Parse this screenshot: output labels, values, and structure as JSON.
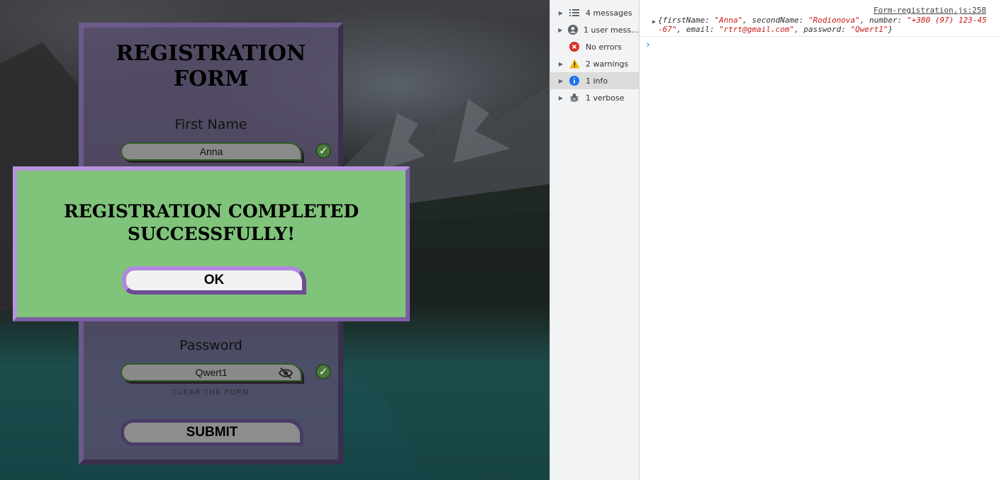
{
  "form": {
    "title": "REGISTRATION FORM",
    "first_name_label": "First Name",
    "first_name_value": "Anna",
    "password_label": "Password",
    "password_value": "Qwert1",
    "clear_label": "CLEAR THE FORM",
    "submit_label": "SUBMIT",
    "check_glyph": "✓"
  },
  "modal": {
    "message": "REGISTRATION COMPLETED SUCCESSFULLY!",
    "ok_label": "OK"
  },
  "devtools": {
    "sidebar": [
      {
        "label": "4 messages",
        "icon": "list-icon",
        "expandable": true
      },
      {
        "label": "1 user mess…",
        "icon": "user-icon",
        "expandable": true
      },
      {
        "label": "No errors",
        "icon": "error-icon",
        "expandable": false
      },
      {
        "label": "2 warnings",
        "icon": "warning-icon",
        "expandable": true
      },
      {
        "label": "1 info",
        "icon": "info-icon",
        "expandable": true,
        "selected": true
      },
      {
        "label": "1 verbose",
        "icon": "bug-icon",
        "expandable": true
      }
    ],
    "source_link": "Form-registration.js:258",
    "log": {
      "open": "{firstName: ",
      "first_name": "\"Anna\"",
      "sep1": ", secondName: ",
      "second_name": "\"Rodionova\"",
      "sep2": ", number: ",
      "number": "\"+380 (97) 123-45-67\"",
      "sep3": ", email: ",
      "email": "\"rtrt@gmail.com\"",
      "sep4": ", password: ",
      "password": "\"Qwert1\"",
      "close": "}"
    },
    "prompt": "›"
  },
  "colors": {
    "modal_bg": "#80c37a",
    "modal_border": "#b893de",
    "card_bg": "#5a506e",
    "input_bg": "#8a8a8a",
    "error_red": "#d93025",
    "warning_yellow": "#f2b600",
    "info_blue": "#1a73e8"
  }
}
